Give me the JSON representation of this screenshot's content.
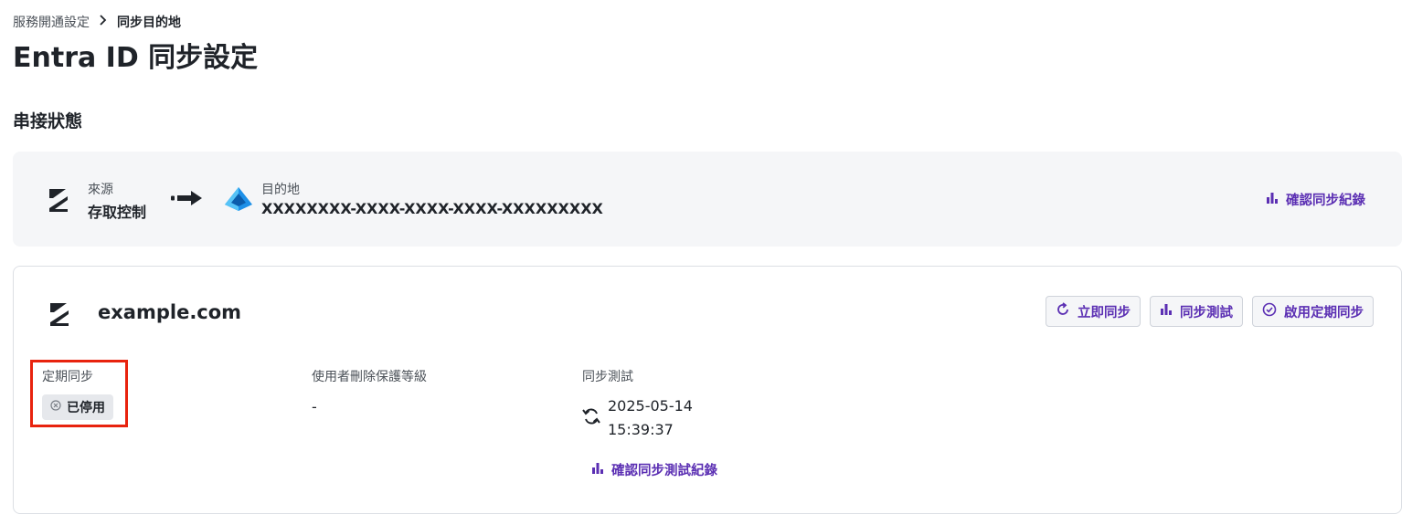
{
  "breadcrumb": {
    "parent": "服務開通設定",
    "current": "同步目的地"
  },
  "page_title": "Entra ID 同步設定",
  "section_title": "串接狀態",
  "connection": {
    "source_label": "來源",
    "source_value": "存取控制",
    "destination_label": "目的地",
    "destination_value": "XXXXXXXX-XXXX-XXXX-XXXX-XXXXXXXXX",
    "log_link": "確認同步紀錄",
    "icons": {
      "source": "access-control-logo-icon",
      "arrow": "arrow-right-icon",
      "destination": "azure-entra-logo-icon",
      "log": "bar-chart-icon"
    }
  },
  "domain_card": {
    "domain": "example.com",
    "actions": {
      "sync_now": "立即同步",
      "sync_test": "同步測試",
      "enable_schedule": "啟用定期同步"
    },
    "scheduled_sync": {
      "label": "定期同步",
      "status": "已停用"
    },
    "delete_protection": {
      "label": "使用者刪除保護等級",
      "value": "-"
    },
    "sync_test_info": {
      "label": "同步測試",
      "date": "2025-05-14",
      "time": "15:39:37",
      "link": "確認同步測試紀錄"
    }
  },
  "colors": {
    "accent": "#5b2fb3",
    "highlight": "#e8230e",
    "panel_bg": "#f5f6f8",
    "text": "#1f2329"
  }
}
